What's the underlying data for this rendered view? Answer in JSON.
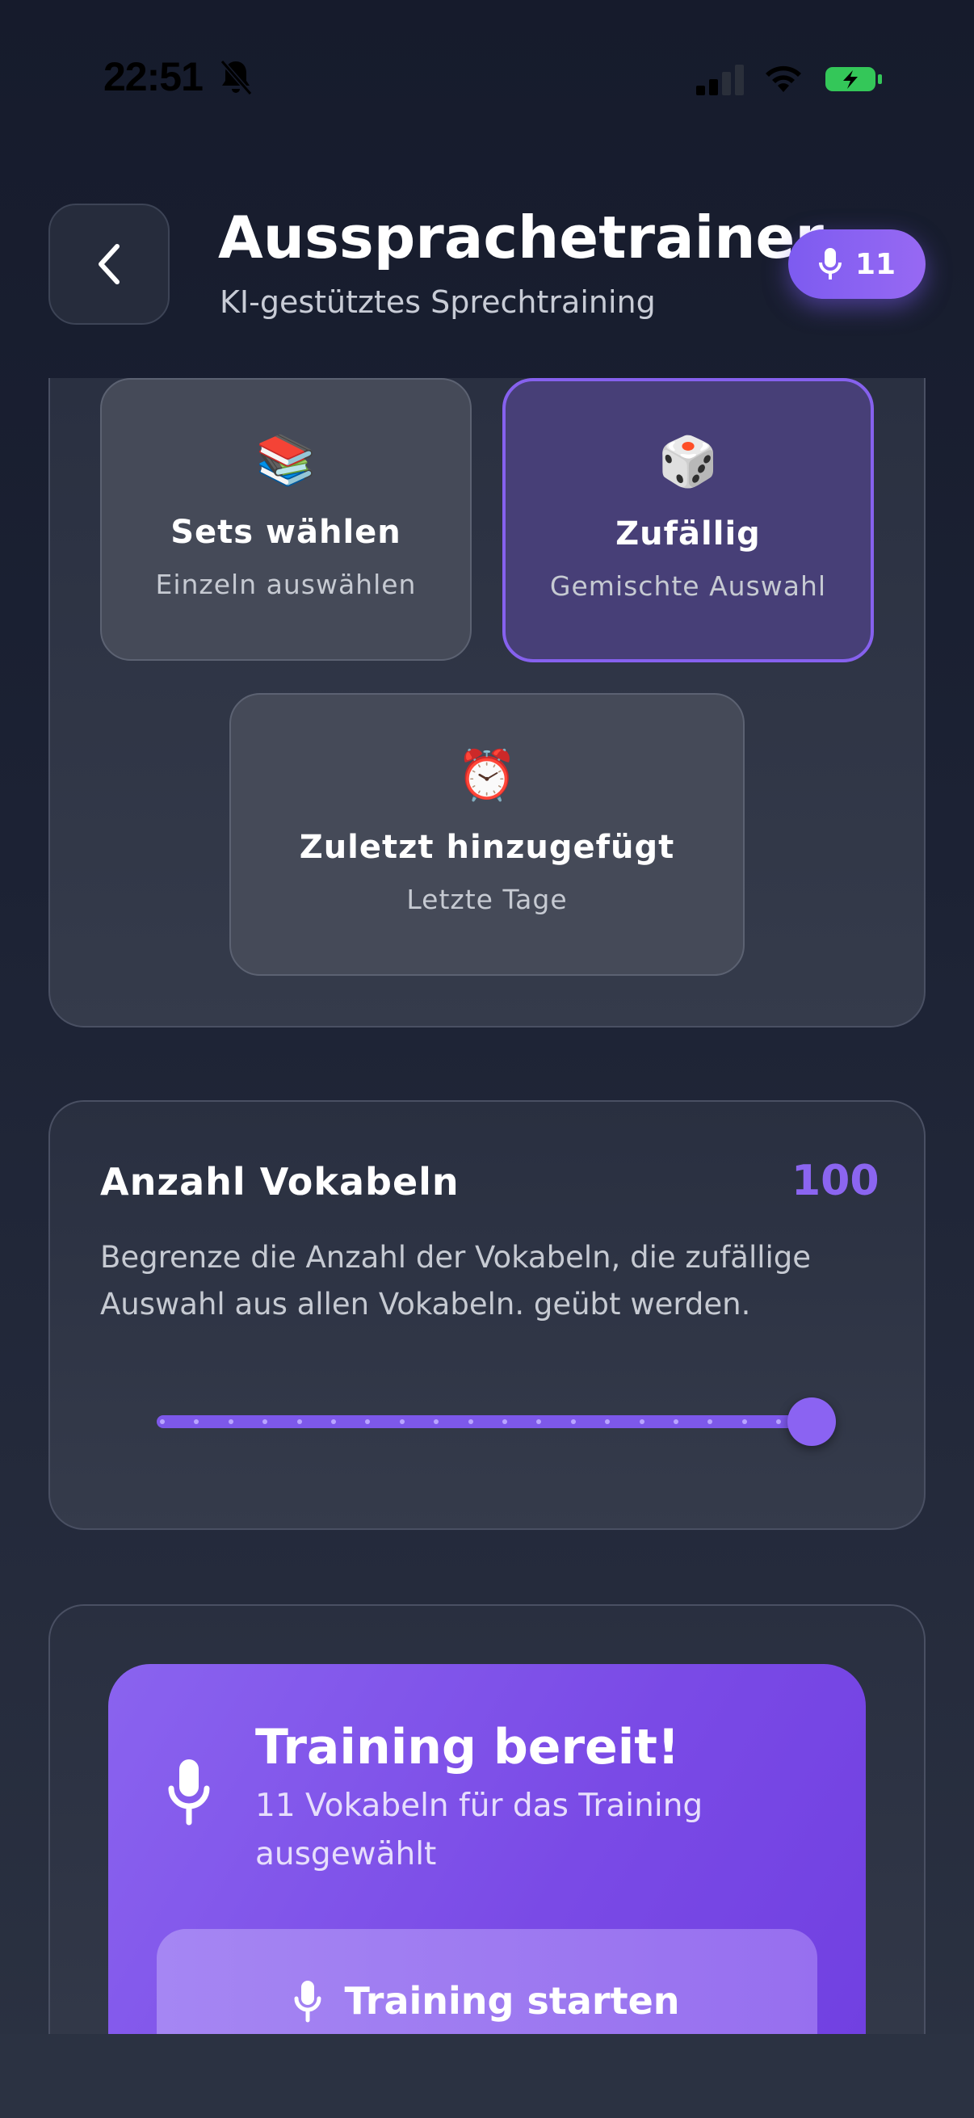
{
  "status_bar": {
    "time": "22:51"
  },
  "header": {
    "title": "Aussprachetrainer",
    "subtitle": "KI-gestütztes Sprechtraining",
    "badge_count": "11"
  },
  "selection_options": [
    {
      "emoji": "📚",
      "title": "Sets wählen",
      "subtitle": "Einzeln auswählen"
    },
    {
      "emoji": "🎲",
      "title": "Zufällig",
      "subtitle": "Gemischte Auswahl"
    },
    {
      "emoji": "⏰",
      "title": "Zuletzt hinzugefügt",
      "subtitle": "Letzte Tage"
    }
  ],
  "vocab_count": {
    "title": "Anzahl Vokabeln",
    "value": "100",
    "description": "Begrenze die Anzahl der Vokabeln, die zufällige Auswahl aus allen Vokabeln. geübt werden.",
    "slider_fraction": 1.0
  },
  "training": {
    "title": "Training bereit!",
    "subtitle": "11 Vokabeln für das Training ausgewählt",
    "button_label": "Training starten"
  },
  "colors": {
    "accent": "#8b65f0",
    "selected_border": "#8661ee"
  },
  "icons": {
    "back": "chevron-left-icon",
    "mic": "microphone-icon",
    "bell": "bell-slash-icon"
  }
}
